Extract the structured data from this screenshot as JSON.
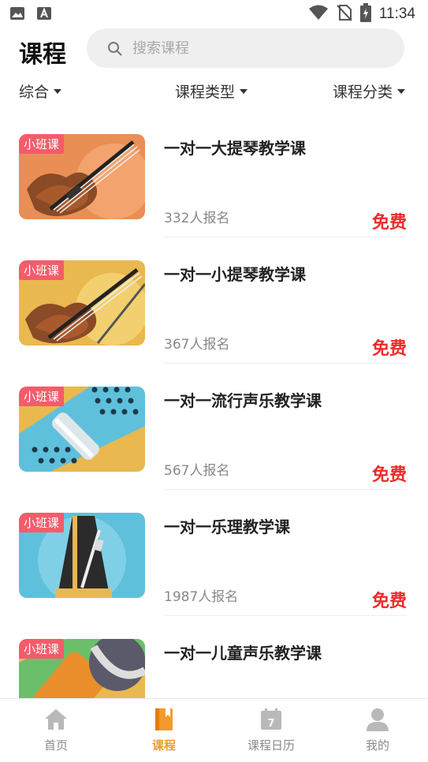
{
  "status_bar": {
    "time": "11:34",
    "icons": [
      "image-icon",
      "a-notification-icon",
      "wifi-icon",
      "no-sim-icon",
      "battery-charging-icon"
    ]
  },
  "header": {
    "title": "课程",
    "search_placeholder": "搜索课程"
  },
  "filters": [
    {
      "label": "综合"
    },
    {
      "label": "课程类型"
    },
    {
      "label": "课程分类"
    }
  ],
  "courses": [
    {
      "tag": "小班课",
      "title": "一对一大提琴教学课",
      "count": "332人报名",
      "price": "免费",
      "thumb": "cello",
      "bg": "#e98e55"
    },
    {
      "tag": "小班课",
      "title": "一对一小提琴教学课",
      "count": "367人报名",
      "price": "免费",
      "thumb": "violin",
      "bg": "#e9b84f"
    },
    {
      "tag": "小班课",
      "title": "一对一流行声乐教学课",
      "count": "567人报名",
      "price": "免费",
      "thumb": "microphone-grill",
      "bg": "#e9b84f"
    },
    {
      "tag": "小班课",
      "title": "一对一乐理教学课",
      "count": "1987人报名",
      "price": "免费",
      "thumb": "metronome",
      "bg": "#5fc0dc"
    },
    {
      "tag": "小班课",
      "title": "一对一儿童声乐教学课",
      "count": "",
      "price": "",
      "thumb": "microphone",
      "bg": "#e9b84f"
    }
  ],
  "bottom_nav": [
    {
      "label": "首页",
      "icon": "home-icon",
      "active": false
    },
    {
      "label": "课程",
      "icon": "book-icon",
      "active": true
    },
    {
      "label": "课程日历",
      "icon": "calendar-icon",
      "active": false,
      "badge": "7"
    },
    {
      "label": "我的",
      "icon": "user-icon",
      "active": false
    }
  ],
  "colors": {
    "accent": "#f39a2c",
    "price": "#ee2a2a",
    "tag": "#f45c6a",
    "nav_inactive": "#b9b9b9"
  }
}
